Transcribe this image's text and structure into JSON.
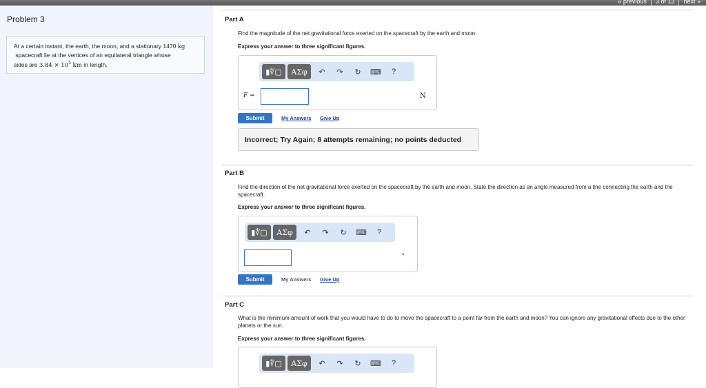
{
  "nav": {
    "previous": "« previous",
    "position": "3 of 13",
    "next": "next »"
  },
  "problem": {
    "title": "Problem 3",
    "text_1": "At a certain instant, the earth, the moon, and a stationary 1470 ",
    "unit_kg": "kg",
    "text_2": "spacecraft lie at the vertices of an equilateral triangle whose",
    "text_3": "sides are ",
    "value": "3.84 × 10",
    "exp": "5",
    "unit_km": " km",
    "text_4": " in length."
  },
  "toolbar": {
    "templates": "▮∜▢",
    "symbols": "ΑΣφ",
    "undo": "↶",
    "redo": "↷",
    "reset": "↻",
    "keyboard": "⌨",
    "help": "?"
  },
  "partA": {
    "label": "Part A",
    "question": "Find the magnitude of the net gravitational force exerted on the spacecraft by the earth and moon.",
    "instruction": "Express your answer to three significant figures.",
    "var": "F =",
    "value": "",
    "unit": "N",
    "submit": "Submit",
    "my_answers": "My Answers",
    "give_up": "Give Up",
    "feedback": "Incorrect; Try Again; 8 attempts remaining; no points deducted"
  },
  "partB": {
    "label": "Part B",
    "question": "Find the direction of the net gravitational force exerted on the spacecraft by the earth and moon. State the direction as an angle measured from a line connecting the earth and the spacecraft.",
    "instruction": "Express your answer to three significant figures.",
    "value": "",
    "unit": "°",
    "submit": "Submit",
    "my_answers": "My Answers",
    "give_up": "Give Up"
  },
  "partC": {
    "label": "Part C",
    "question": "What is the minimum amount of work that you would have to do to move the spacecraft to a point far from the earth and moon? You can ignore any gravitational effects due to the other planets or the sun.",
    "instruction": "Express your answer to three significant figures."
  }
}
